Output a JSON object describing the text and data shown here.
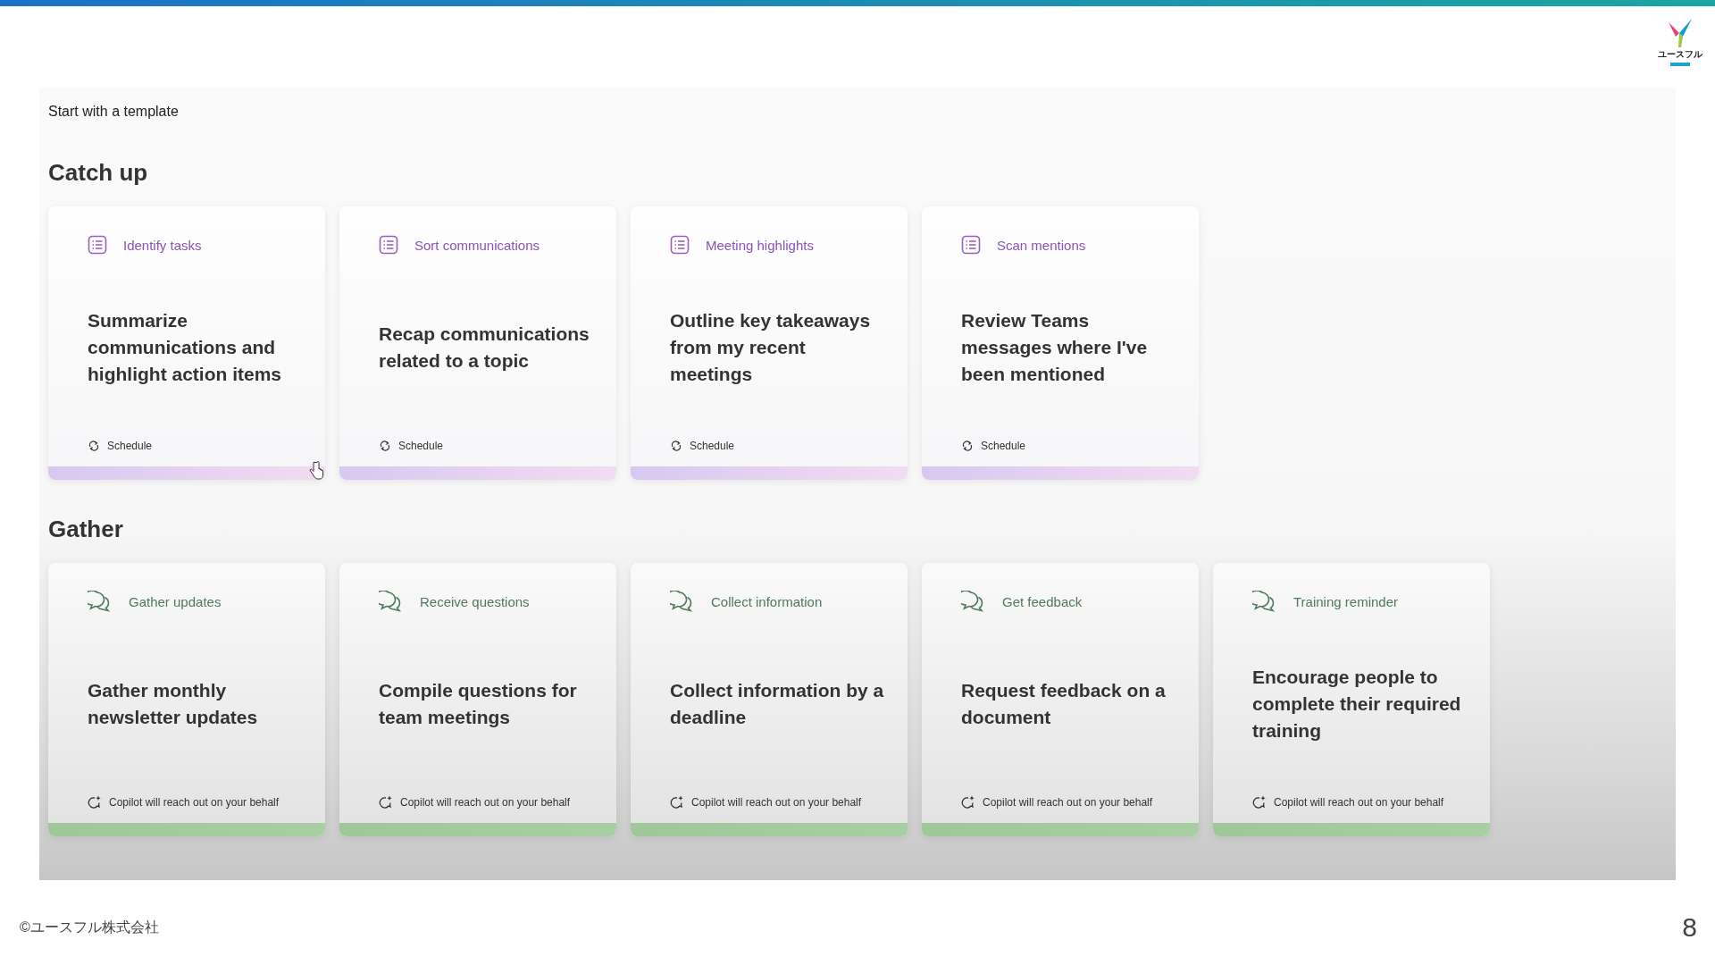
{
  "slide": {
    "logo_text": "ユースフル",
    "footer": "©ユースフル株式会社",
    "page_number": "8"
  },
  "screen": {
    "heading": "Start with a template",
    "sections": [
      {
        "title": "Catch up",
        "kind": "schedule",
        "cards": [
          {
            "category": "Identify tasks",
            "title": "Summarize communications and highlight action items",
            "footer": "Schedule"
          },
          {
            "category": "Sort communications",
            "title": "Recap communications related to a topic",
            "footer": "Schedule"
          },
          {
            "category": "Meeting highlights",
            "title": "Outline key takeaways from my recent meetings",
            "footer": "Schedule"
          },
          {
            "category": "Scan mentions",
            "title": "Review Teams messages where I've been mentioned",
            "footer": "Schedule"
          }
        ]
      },
      {
        "title": "Gather",
        "kind": "reach-out",
        "cards": [
          {
            "category": "Gather updates",
            "title": "Gather monthly newsletter updates",
            "footer": "Copilot will reach out on your behalf"
          },
          {
            "category": "Receive questions",
            "title": "Compile questions for team meetings",
            "footer": "Copilot will reach out on your behalf"
          },
          {
            "category": "Collect information",
            "title": "Collect information by a deadline",
            "footer": "Copilot will reach out on your behalf"
          },
          {
            "category": "Get feedback",
            "title": "Request feedback on a document",
            "footer": "Copilot will reach out on your behalf"
          },
          {
            "category": "Training reminder",
            "title": "Encourage people to complete their required training",
            "footer": "Copilot will reach out on your behalf"
          }
        ]
      }
    ]
  }
}
